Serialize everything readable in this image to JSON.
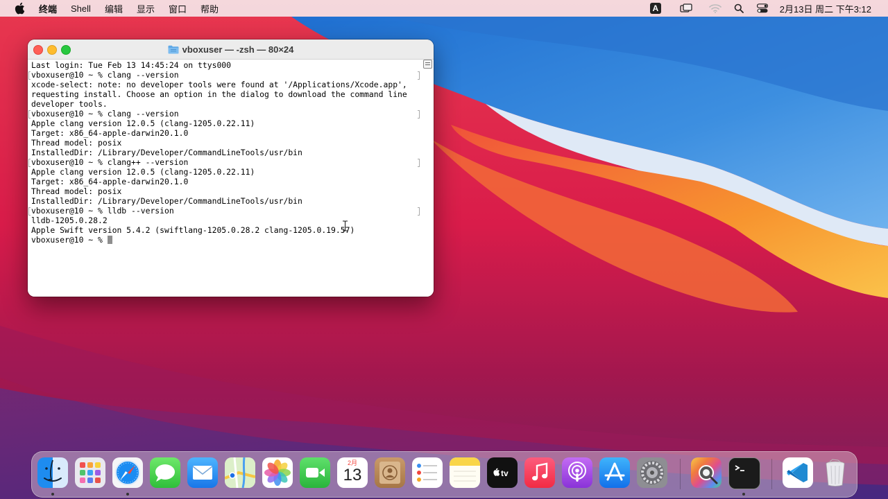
{
  "menubar": {
    "items": [
      "终端",
      "Shell",
      "编辑",
      "显示",
      "窗口",
      "帮助"
    ],
    "input_method": "A",
    "clock": "2月13日 周二 下午3:12"
  },
  "terminal": {
    "title": "vboxuser — -zsh — 80×24",
    "lines": [
      {
        "text": "Last login: Tue Feb 13 14:45:24 on ttys000",
        "prompt": false
      },
      {
        "text": "vboxuser@10 ~ % clang --version",
        "prompt": true
      },
      {
        "text": "xcode-select: note: no developer tools were found at '/Applications/Xcode.app',",
        "prompt": false
      },
      {
        "text": "requesting install. Choose an option in the dialog to download the command line",
        "prompt": false
      },
      {
        "text": "developer tools.",
        "prompt": false
      },
      {
        "text": "vboxuser@10 ~ % clang --version",
        "prompt": true
      },
      {
        "text": "Apple clang version 12.0.5 (clang-1205.0.22.11)",
        "prompt": false
      },
      {
        "text": "Target: x86_64-apple-darwin20.1.0",
        "prompt": false
      },
      {
        "text": "Thread model: posix",
        "prompt": false
      },
      {
        "text": "InstalledDir: /Library/Developer/CommandLineTools/usr/bin",
        "prompt": false
      },
      {
        "text": "vboxuser@10 ~ % clang++ --version",
        "prompt": true
      },
      {
        "text": "Apple clang version 12.0.5 (clang-1205.0.22.11)",
        "prompt": false
      },
      {
        "text": "Target: x86_64-apple-darwin20.1.0",
        "prompt": false
      },
      {
        "text": "Thread model: posix",
        "prompt": false
      },
      {
        "text": "InstalledDir: /Library/Developer/CommandLineTools/usr/bin",
        "prompt": false
      },
      {
        "text": "vboxuser@10 ~ % lldb --version",
        "prompt": true
      },
      {
        "text": "lldb-1205.0.28.2",
        "prompt": false
      },
      {
        "text": "Apple Swift version 5.4.2 (swiftlang-1205.0.28.2 clang-1205.0.19.57)",
        "prompt": false
      }
    ],
    "current_prompt": "vboxuser@10 ~ % "
  },
  "dock": {
    "calendar_month": "2月",
    "calendar_day": "13",
    "apps": [
      {
        "name": "finder",
        "running": true
      },
      {
        "name": "launchpad",
        "running": false
      },
      {
        "name": "safari",
        "running": true
      },
      {
        "name": "messages",
        "running": false
      },
      {
        "name": "mail",
        "running": false
      },
      {
        "name": "maps",
        "running": false
      },
      {
        "name": "photos",
        "running": false
      },
      {
        "name": "facetime",
        "running": false
      },
      {
        "name": "calendar",
        "running": false
      },
      {
        "name": "contacts",
        "running": false
      },
      {
        "name": "reminders",
        "running": false
      },
      {
        "name": "notes",
        "running": false
      },
      {
        "name": "apple-tv",
        "running": false
      },
      {
        "name": "music",
        "running": false
      },
      {
        "name": "podcasts",
        "running": false
      },
      {
        "name": "app-store",
        "running": false
      },
      {
        "name": "system-preferences",
        "running": false
      },
      {
        "name": "color-picker",
        "running": false
      },
      {
        "name": "terminal",
        "running": true
      },
      {
        "name": "vscode",
        "running": false
      },
      {
        "name": "trash",
        "running": false
      }
    ]
  },
  "colors": {
    "close": "#ff5f57",
    "minimize": "#febc2e",
    "maximize": "#28c840"
  }
}
